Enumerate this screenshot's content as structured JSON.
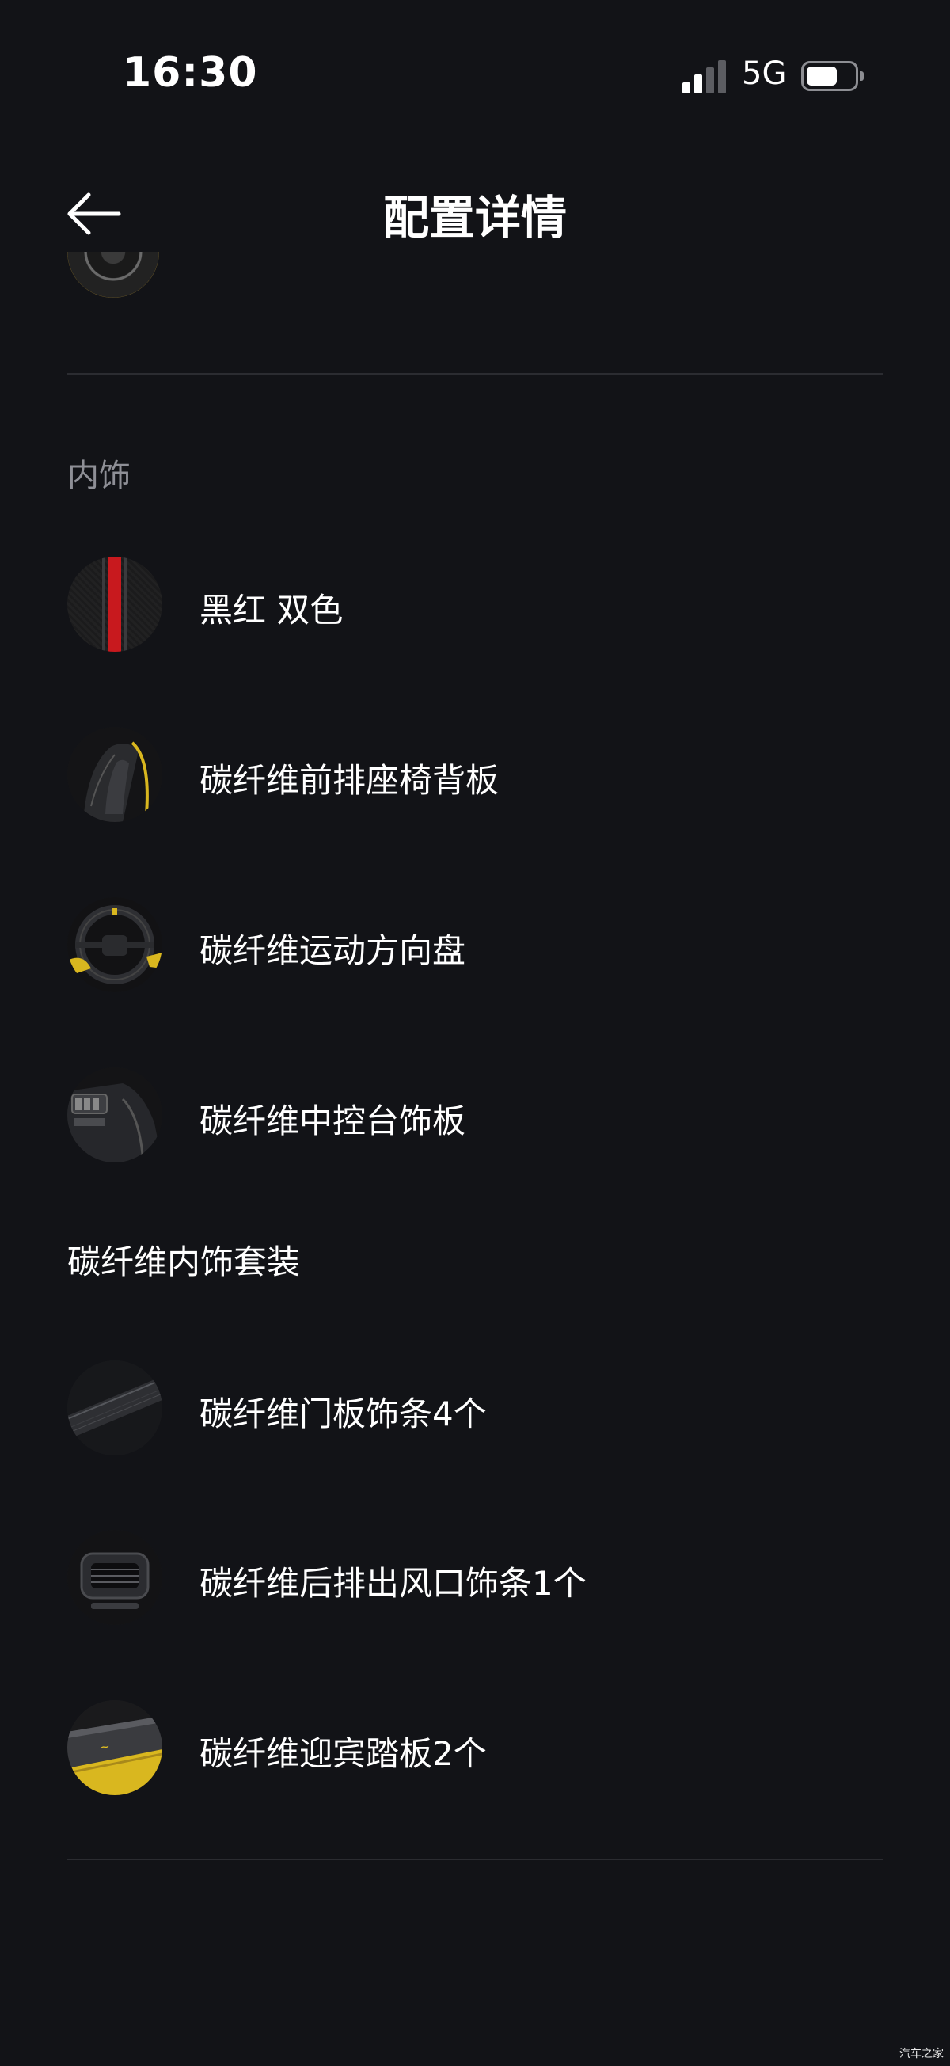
{
  "status_bar": {
    "time": "16:30",
    "network": "5G",
    "signal_bars": 2,
    "battery_level": 0.55
  },
  "header": {
    "title": "配置详情",
    "back_icon": "arrow-left-icon"
  },
  "interior": {
    "section_label": "内饰",
    "items": [
      {
        "label": "黑红 双色",
        "icon": "black-red-fabric-swatch"
      },
      {
        "label": "碳纤维前排座椅背板",
        "icon": "seat-back-panel-photo"
      },
      {
        "label": "碳纤维运动方向盘",
        "icon": "steering-wheel-photo"
      },
      {
        "label": "碳纤维中控台饰板",
        "icon": "center-console-photo"
      }
    ],
    "package": {
      "label": "碳纤维内饰套装",
      "items": [
        {
          "label": "碳纤维门板饰条4个",
          "icon": "door-trim-photo"
        },
        {
          "label": "碳纤维后排出风口饰条1个",
          "icon": "rear-vent-photo"
        },
        {
          "label": "碳纤维迎宾踏板2个",
          "icon": "sill-plate-photo"
        }
      ]
    }
  },
  "watermark": "汽车之家",
  "colors": {
    "background": "#121317",
    "divider": "#2b2c31",
    "section_label": "#8e8f96",
    "accent_red": "#c8191e",
    "accent_yellow": "#e2c021"
  }
}
